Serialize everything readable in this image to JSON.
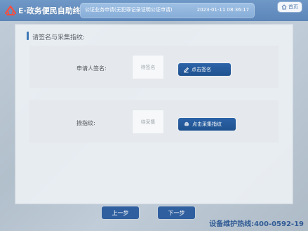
{
  "header": {
    "logo_text": "E·政务便民自助终端",
    "title": "公证业务申请(无犯罪记录证明公证申请)",
    "datetime": "2023-01-11 08:36:17",
    "home_label": "首页"
  },
  "page": {
    "section_title": "请签名与采集指纹:",
    "rows": [
      {
        "label": "申请人签名:",
        "placeholder": "待签名",
        "button_label": "点击签名"
      },
      {
        "label": "捺指纹:",
        "placeholder": "待采集",
        "button_label": "点击采集指纹"
      }
    ]
  },
  "footer": {
    "prev_label": "上一步",
    "next_label": "下一步",
    "hotline": "设备维护热线:400-0592-19"
  },
  "colors": {
    "header": "#5c86b9",
    "title_bar": "#86acd7",
    "button_blue": "#2c63a8",
    "hotline_text": "#325c95"
  },
  "icons": {
    "logo": "logo-icon",
    "home": "home-icon",
    "sign": "pen-icon",
    "fingerprint": "fingerprint-icon"
  }
}
